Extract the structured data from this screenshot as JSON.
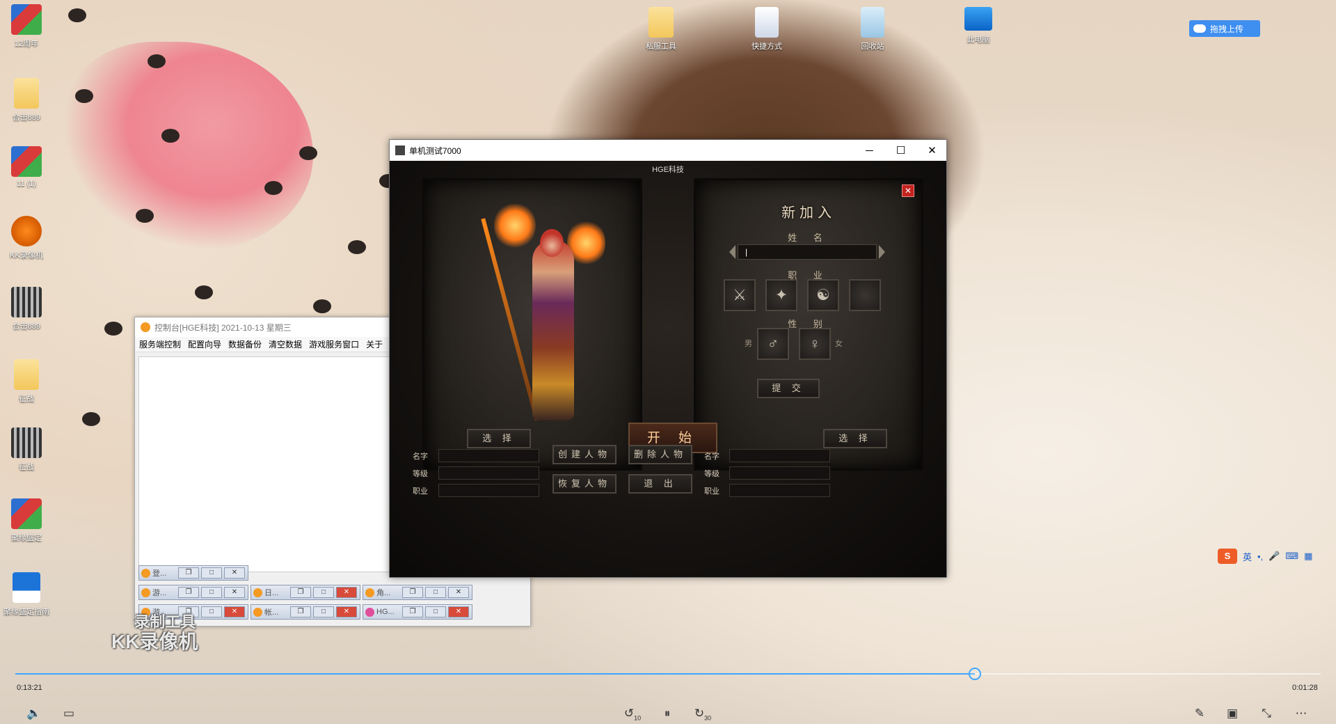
{
  "desktop": {
    "left_icons": [
      {
        "label": "12周年",
        "icon": "winrar-icon"
      },
      {
        "label": "合击889",
        "icon": "folder-icon"
      },
      {
        "label": "11 (1)",
        "icon": "winrar-icon"
      },
      {
        "label": "KK录像机",
        "icon": "kk-recorder-icon"
      },
      {
        "label": "合击889",
        "icon": "qr-app-icon"
      },
      {
        "label": "征战",
        "icon": "folder-icon"
      },
      {
        "label": "征战",
        "icon": "qr-app-icon"
      },
      {
        "label": "聚缘盛定",
        "icon": "winrar-icon"
      },
      {
        "label": "聚缘盛定指南",
        "icon": "blue-app-icon"
      }
    ],
    "top_icons": [
      {
        "label": "私服工具",
        "icon": "folder-icon"
      },
      {
        "label": "快捷方式",
        "icon": "shortcut-icon"
      },
      {
        "label": "回收站",
        "icon": "recycle-bin-icon"
      },
      {
        "label": "此电脑",
        "icon": "this-pc-icon"
      }
    ],
    "upload_button": "拖拽上传"
  },
  "console": {
    "title": "控制台[HGE科技] 2021-10-13 星期三",
    "menu": [
      "服务端控制",
      "配置向导",
      "数据备份",
      "清空数据",
      "游戏服务窗口",
      "关于"
    ],
    "mdi_rows": [
      [
        {
          "label": "登..."
        }
      ],
      [
        {
          "label": "游..."
        },
        {
          "label": "日..."
        },
        {
          "label": "角..."
        }
      ],
      [
        {
          "label": "游..."
        },
        {
          "label": "帐..."
        },
        {
          "label": "HG..."
        }
      ]
    ]
  },
  "game": {
    "title": "单机测试7000",
    "brand": "HGE科技",
    "create_panel": {
      "title": "新加入",
      "name_label": "姓 名",
      "name_value": "|",
      "job_label": "职 业",
      "gender_label": "性 别",
      "male": "男",
      "female": "女",
      "submit": "提 交"
    },
    "buttons": {
      "select_left": "选 择",
      "start": "开 始",
      "select_right": "选 择",
      "create": "创建人物",
      "delete": "删除人物",
      "restore": "恢复人物",
      "exit": "退 出"
    },
    "info_labels": {
      "name": "名字",
      "level": "等级",
      "job": "职业"
    }
  },
  "ime": {
    "lang": "英",
    "punct": "•,",
    "logo": "S"
  },
  "watermark": {
    "line1": "录制工具",
    "line2": "KK录像机"
  },
  "player": {
    "current_time": "0:13:21",
    "total_time": "0:01:28",
    "progress_fraction": 0.735,
    "controls": {
      "rewind": "10",
      "forward": "30"
    }
  },
  "colors": {
    "accent": "#3ea6ff",
    "game_bg": "#151210",
    "close_red": "#c2231d"
  }
}
